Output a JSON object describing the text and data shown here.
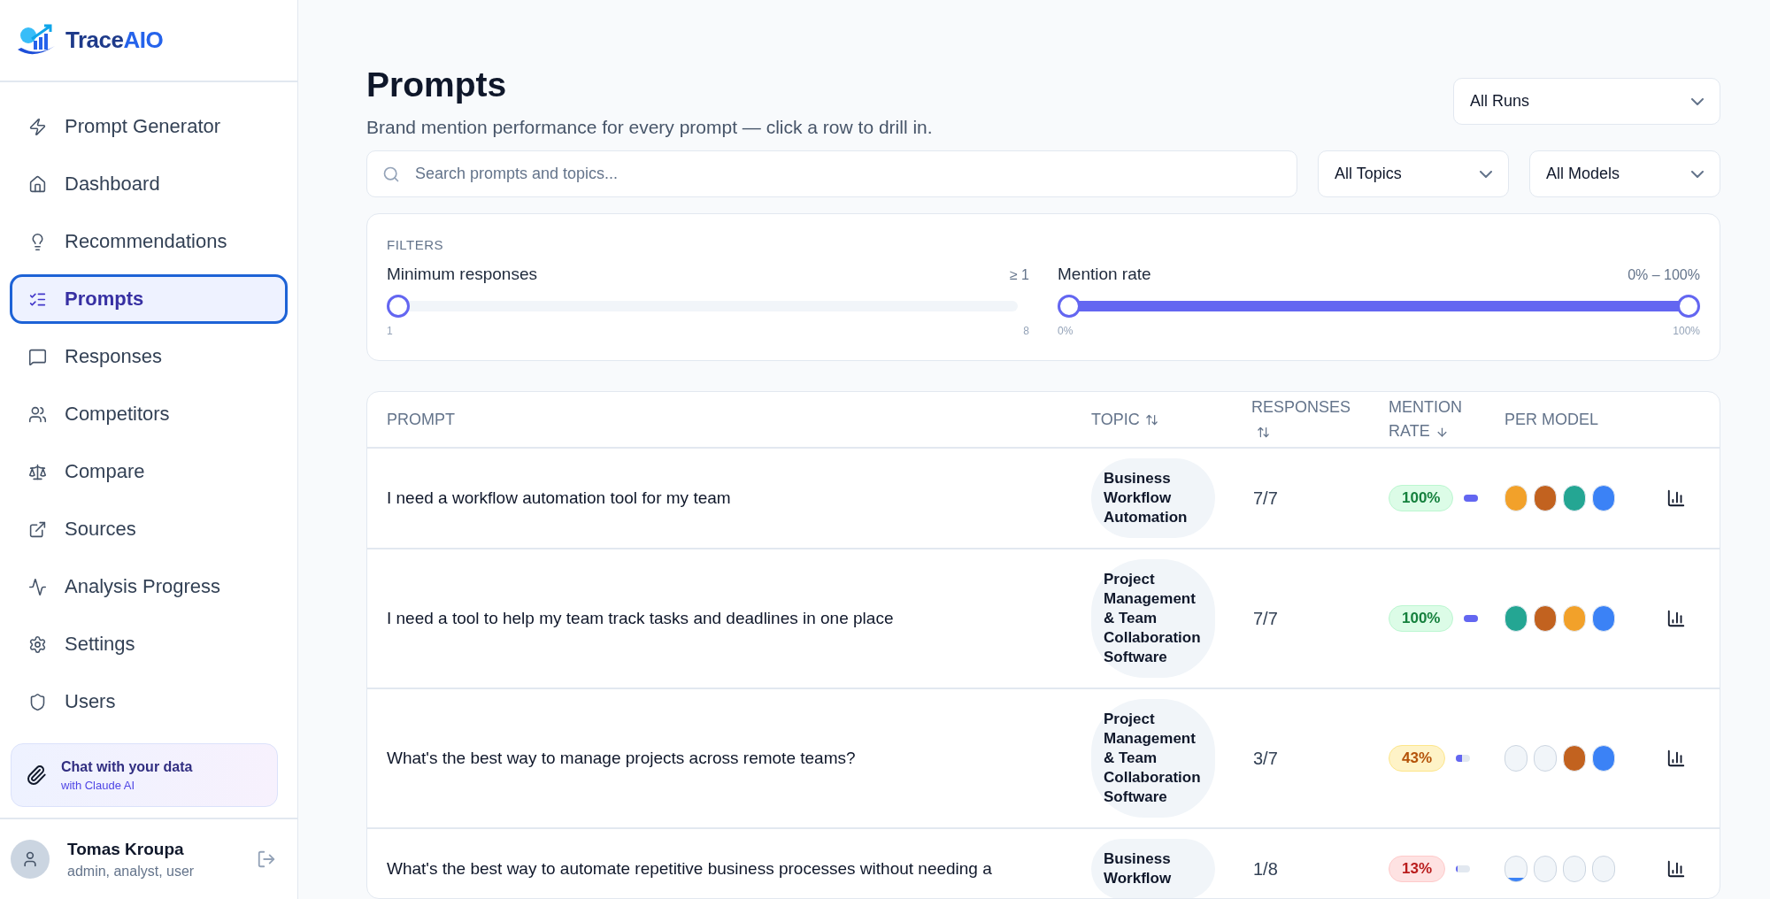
{
  "brand": {
    "name": "Trace",
    "suffix": "AIO"
  },
  "nav": [
    {
      "label": "Prompt Generator",
      "selected": false
    },
    {
      "label": "Dashboard",
      "selected": false
    },
    {
      "label": "Recommendations",
      "selected": false
    },
    {
      "label": "Prompts",
      "selected": true
    },
    {
      "label": "Responses",
      "selected": false
    },
    {
      "label": "Competitors",
      "selected": false
    },
    {
      "label": "Compare",
      "selected": false
    },
    {
      "label": "Sources",
      "selected": false
    },
    {
      "label": "Analysis Progress",
      "selected": false
    },
    {
      "label": "Settings",
      "selected": false
    },
    {
      "label": "Users",
      "selected": false
    }
  ],
  "chat_card": {
    "title": "Chat with your data",
    "subtitle": "with Claude AI"
  },
  "user": {
    "name": "Tomas Kroupa",
    "roles": "admin, analyst, user"
  },
  "header": {
    "title": "Prompts",
    "subtitle": "Brand mention performance for every prompt — click a row to drill in.",
    "runs_select": "All Runs"
  },
  "search": {
    "placeholder": "Search prompts and topics..."
  },
  "topic_select": "All Topics",
  "model_select": "All Models",
  "filters": {
    "heading": "FILTERS",
    "min_responses": {
      "label": "Minimum responses",
      "reading": "≥ 1",
      "level": 0,
      "min_label": "1",
      "max_label": "8"
    },
    "mention_rate": {
      "label": "Mention rate",
      "reading": "0% – 100%",
      "thumbs": [
        {
          "level": 0
        },
        {
          "level": 1
        }
      ],
      "min_label": "0%",
      "max_label": "100%"
    }
  },
  "table": {
    "columns": [
      {
        "label": "PROMPT",
        "kind": "plain"
      },
      {
        "label": "TOPIC",
        "kind": "sortable"
      },
      {
        "label": "RESPONSES",
        "kind": "sortable"
      },
      {
        "label": "MENTION RATE",
        "kind": "descending"
      },
      {
        "label": "PER MODEL",
        "kind": "plain"
      }
    ],
    "rows": [
      {
        "prompt": "I need a workflow automation tool for my team",
        "topic": "Business Workflow Automation",
        "responses": "7/7",
        "rate": "100%",
        "level": 1,
        "models": [
          {
            "kind": "full",
            "color": "#f2a12a"
          },
          {
            "kind": "full",
            "color": "#c2621f"
          },
          {
            "kind": "full",
            "color": "#24a693"
          },
          {
            "kind": "full",
            "color": "#3b82f6"
          }
        ]
      },
      {
        "prompt": "I need a tool to help my team track tasks and deadlines in one place",
        "topic": "Project Management & Team Collaboration Software",
        "responses": "7/7",
        "rate": "100%",
        "level": 1,
        "models": [
          {
            "kind": "full",
            "color": "#24a693"
          },
          {
            "kind": "full",
            "color": "#c2621f"
          },
          {
            "kind": "full",
            "color": "#f2a12a"
          },
          {
            "kind": "full",
            "color": "#3b82f6"
          }
        ]
      },
      {
        "prompt": "What's the best way to manage projects across remote teams?",
        "topic": "Project Management & Team Collaboration Software",
        "responses": "3/7",
        "rate": "43%",
        "level": 0.43,
        "models": [
          {
            "kind": "empty"
          },
          {
            "kind": "empty"
          },
          {
            "kind": "full",
            "color": "#c2621f"
          },
          {
            "kind": "full",
            "color": "#3b82f6"
          }
        ]
      },
      {
        "prompt": "What's the best way to automate repetitive business processes without needing a",
        "topic": "Business Workflow",
        "responses": "1/8",
        "rate": "13%",
        "level": 0.13,
        "models": [
          {
            "kind": "partial",
            "color": "#3b82f6",
            "level": 0.15
          },
          {
            "kind": "empty"
          },
          {
            "kind": "empty"
          },
          {
            "kind": "empty"
          }
        ]
      }
    ]
  }
}
